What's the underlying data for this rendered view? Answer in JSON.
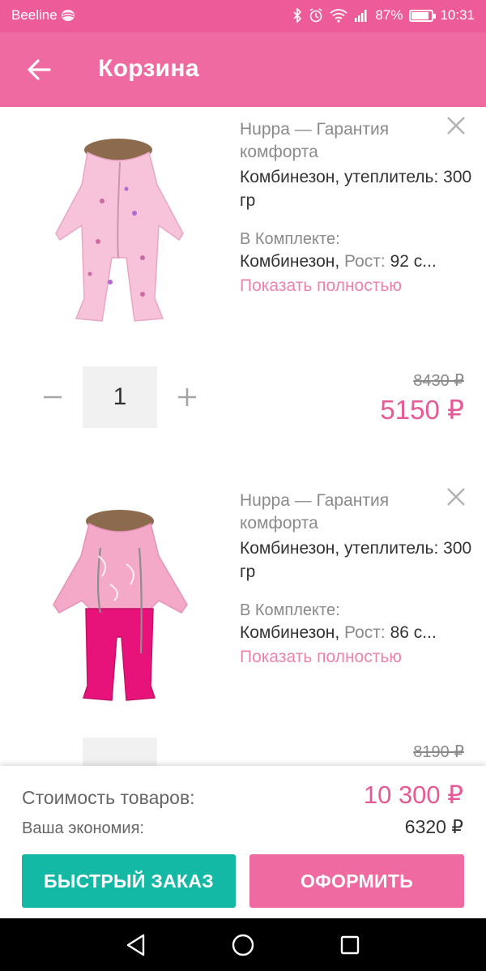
{
  "status_bar": {
    "carrier": "Beeline",
    "battery_percent": "87%",
    "battery_level": 0.87,
    "time": "10:31"
  },
  "toolbar": {
    "title": "Корзина",
    "back_icon": "arrow-left-icon"
  },
  "cart": {
    "items": [
      {
        "brand": "Huppa — Гарантия комфорта",
        "name": "Комбинезон, утеплитель: 300 гр",
        "set_label": "В Комплекте:",
        "set_item": "Комбинезон,",
        "set_size_label": "Рост:",
        "set_size_value": "92 с...",
        "show_more": "Показать полностью",
        "quantity": "1",
        "old_price": "8430 ₽",
        "price": "5150 ₽",
        "colors": {
          "top": "#f6c3da",
          "bottom": "#f6c3da"
        }
      },
      {
        "brand": "Huppa — Гарантия комфорта",
        "name": "Комбинезон, утеплитель: 300 гр",
        "set_label": "В Комплекте:",
        "set_item": "Комбинезон,",
        "set_size_label": "Рост:",
        "set_size_value": "86 с...",
        "show_more": "Показать полностью",
        "quantity": "",
        "old_price": "8190 ₽",
        "price": "",
        "colors": {
          "top": "#f5a9c8",
          "bottom": "#e8137a"
        }
      }
    ]
  },
  "summary": {
    "goods_cost_label": "Стоимость товаров:",
    "goods_cost_value": "10 300 ₽",
    "savings_label": "Ваша экономия:",
    "savings_value": "6320 ₽",
    "quick_order_label": "БЫСТРЫЙ ЗАКАЗ",
    "checkout_label": "ОФОРМИТЬ"
  },
  "colors": {
    "brand_pink": "#f06aa2",
    "status_pink": "#ed5c98",
    "price_pink": "#e65a96",
    "teal": "#14b9a6"
  }
}
